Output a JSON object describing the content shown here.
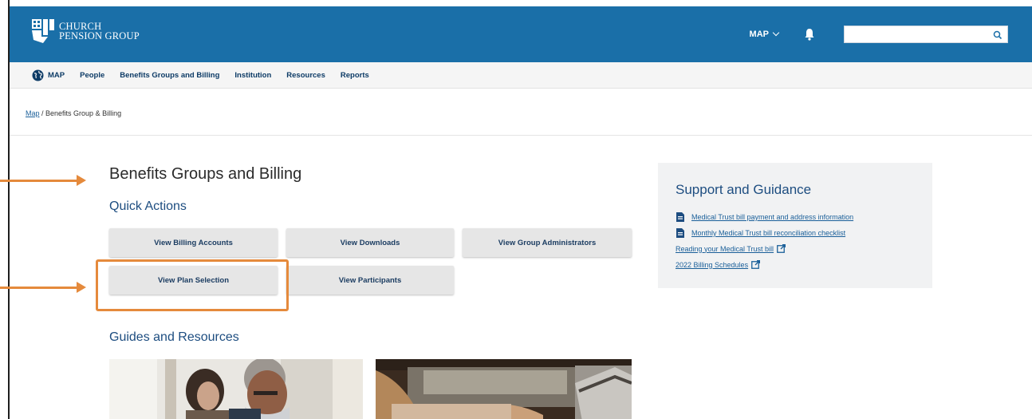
{
  "header": {
    "logo_line1": "CHURCH",
    "logo_line2": "PENSION GROUP",
    "map_menu": "MAP",
    "search_placeholder": ""
  },
  "nav": {
    "items": [
      "MAP",
      "People",
      "Benefits Groups and Billing",
      "Institution",
      "Resources",
      "Reports"
    ]
  },
  "breadcrumb": {
    "link": "Map",
    "separator": " / ",
    "current": "Benefits Group & Billing"
  },
  "main": {
    "title": "Benefits Groups and Billing",
    "quick_actions_title": "Quick Actions",
    "buttons": [
      "View Billing Accounts",
      "View Downloads",
      "View Group Administrators",
      "View Plan Selection",
      "View Participants"
    ],
    "guides_title": "Guides and Resources"
  },
  "support": {
    "title": "Support and Guidance",
    "links": [
      {
        "text": "Medical Trust bill payment and address information",
        "icon": "document-icon"
      },
      {
        "text": "Monthly Medical Trust bill reconciliation checklist",
        "icon": "document-icon"
      },
      {
        "text": "Reading your Medical Trust bill",
        "icon": "external-link-icon"
      },
      {
        "text": "2022 Billing Schedules",
        "icon": "external-link-icon"
      }
    ]
  },
  "colors": {
    "header_bg": "#1a6fa8",
    "nav_text": "#0d3b66",
    "highlight": "#e58a3c",
    "section_title": "#1d4d80"
  }
}
